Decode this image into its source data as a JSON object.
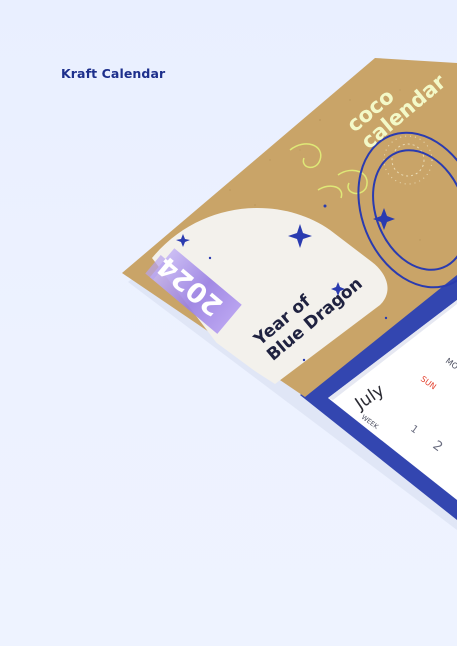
{
  "brand": {
    "title": "Kraft Calendar"
  },
  "calendar": {
    "logo_line1": "coco",
    "logo_line2": "calendar",
    "year": "2024",
    "theme_line1": "Year of",
    "theme_line2": "Blue Dragon",
    "month": "July",
    "week_label": "WEEK",
    "day_sun": "SUN",
    "day_mon": "MO",
    "week_1": "1",
    "week_2": "2"
  },
  "colors": {
    "background": "#ecf1ff",
    "brand_blue": "#1d2f8c",
    "kraft": "#c9a468",
    "calendar_blue": "#3346b0",
    "accent_lime": "#e3f57a",
    "sunday_red": "#e4412f",
    "paint_purple": "#a68ee6"
  }
}
